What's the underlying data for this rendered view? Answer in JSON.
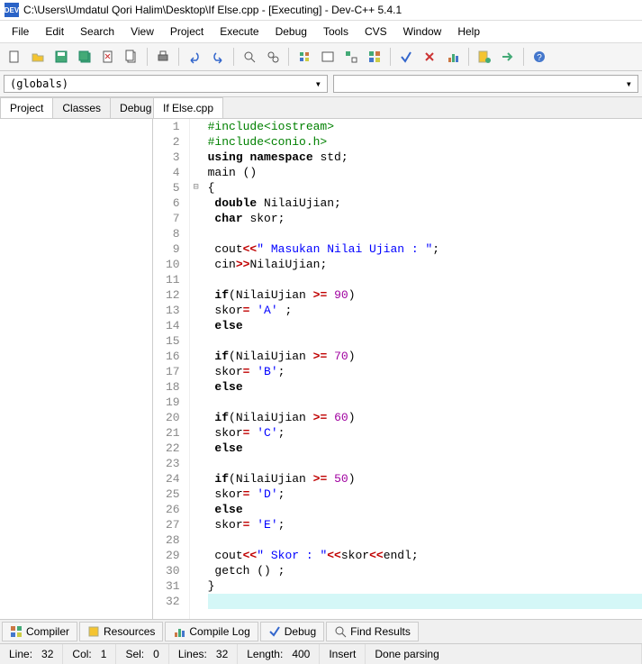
{
  "title": "C:\\Users\\Umdatul Qori Halim\\Desktop\\If Else.cpp - [Executing] - Dev-C++ 5.4.1",
  "appicon": "DEV",
  "menu": [
    "File",
    "Edit",
    "Search",
    "View",
    "Project",
    "Execute",
    "Debug",
    "Tools",
    "CVS",
    "Window",
    "Help"
  ],
  "combo1": "(globals)",
  "leftTabs": [
    "Project",
    "Classes",
    "Debug"
  ],
  "leftActive": 0,
  "editorTab": "If Else.cpp",
  "code": [
    {
      "n": 1,
      "html": "<span class='pp'>#include&lt;iostream&gt;</span>"
    },
    {
      "n": 2,
      "html": "<span class='pp'>#include&lt;conio.h&gt;</span>"
    },
    {
      "n": 3,
      "html": "<span class='kw'>using</span> <span class='kw'>namespace</span> std;"
    },
    {
      "n": 4,
      "html": "main ()"
    },
    {
      "n": 5,
      "html": "{",
      "fold": "⊟"
    },
    {
      "n": 6,
      "html": " <span class='kw'>double</span> NilaiUjian;"
    },
    {
      "n": 7,
      "html": " <span class='kw'>char</span> skor;"
    },
    {
      "n": 8,
      "html": ""
    },
    {
      "n": 9,
      "html": " cout<span class='op'>&lt;&lt;</span><span class='str'>\" Masukan Nilai Ujian : \"</span>;"
    },
    {
      "n": 10,
      "html": " cin<span class='op'>&gt;&gt;</span>NilaiUjian;"
    },
    {
      "n": 11,
      "html": ""
    },
    {
      "n": 12,
      "html": " <span class='kw'>if</span>(NilaiUjian <span class='op'>&gt;=</span> <span class='num'>90</span>)"
    },
    {
      "n": 13,
      "html": " skor<span class='op'>=</span> <span class='str'>'A'</span> ;"
    },
    {
      "n": 14,
      "html": " <span class='kw'>else</span>"
    },
    {
      "n": 15,
      "html": ""
    },
    {
      "n": 16,
      "html": " <span class='kw'>if</span>(NilaiUjian <span class='op'>&gt;=</span> <span class='num'>70</span>)"
    },
    {
      "n": 17,
      "html": " skor<span class='op'>=</span> <span class='str'>'B'</span>;"
    },
    {
      "n": 18,
      "html": " <span class='kw'>else</span>"
    },
    {
      "n": 19,
      "html": ""
    },
    {
      "n": 20,
      "html": " <span class='kw'>if</span>(NilaiUjian <span class='op'>&gt;=</span> <span class='num'>60</span>)"
    },
    {
      "n": 21,
      "html": " skor<span class='op'>=</span> <span class='str'>'C'</span>;"
    },
    {
      "n": 22,
      "html": " <span class='kw'>else</span>"
    },
    {
      "n": 23,
      "html": ""
    },
    {
      "n": 24,
      "html": " <span class='kw'>if</span>(NilaiUjian <span class='op'>&gt;=</span> <span class='num'>50</span>)"
    },
    {
      "n": 25,
      "html": " skor<span class='op'>=</span> <span class='str'>'D'</span>;"
    },
    {
      "n": 26,
      "html": " <span class='kw'>else</span>"
    },
    {
      "n": 27,
      "html": " skor<span class='op'>=</span> <span class='str'>'E'</span>;"
    },
    {
      "n": 28,
      "html": ""
    },
    {
      "n": 29,
      "html": " cout<span class='op'>&lt;&lt;</span><span class='str'>\" Skor : \"</span><span class='op'>&lt;&lt;</span>skor<span class='op'>&lt;&lt;</span>endl;"
    },
    {
      "n": 30,
      "html": " getch () ;"
    },
    {
      "n": 31,
      "html": "}"
    },
    {
      "n": 32,
      "html": "",
      "hl": true
    }
  ],
  "bottomTabs": [
    {
      "icon": "grid",
      "label": "Compiler"
    },
    {
      "icon": "box",
      "label": "Resources"
    },
    {
      "icon": "chart",
      "label": "Compile Log"
    },
    {
      "icon": "check",
      "label": "Debug"
    },
    {
      "icon": "search",
      "label": "Find Results"
    }
  ],
  "status": {
    "line_lbl": "Line:",
    "line": "32",
    "col_lbl": "Col:",
    "col": "1",
    "sel_lbl": "Sel:",
    "sel": "0",
    "lines_lbl": "Lines:",
    "lines": "32",
    "len_lbl": "Length:",
    "len": "400",
    "mode": "Insert",
    "msg": "Done parsing"
  }
}
